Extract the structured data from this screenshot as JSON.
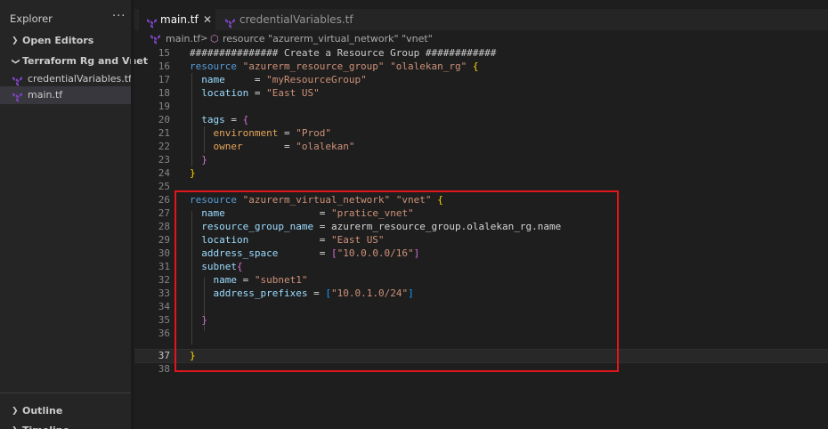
{
  "sidebar": {
    "title": "Explorer",
    "more": "···",
    "sections": {
      "open_editors": "Open Editors",
      "folder": "Terraform Rg and Vnet",
      "outline": "Outline",
      "timeline": "Timeline"
    },
    "files": [
      {
        "name": "credentialVariables.tf"
      },
      {
        "name": "main.tf"
      }
    ]
  },
  "tabs": [
    {
      "label": "main.tf",
      "close": "✕",
      "active": true
    },
    {
      "label": "credentialVariables.tf",
      "active": false
    }
  ],
  "breadcrumb": {
    "file": "main.tf",
    "sep": ">",
    "symbol": "resource \"azurerm_virtual_network\" \"vnet\""
  },
  "colors": {
    "terraform_icon": "#7b42bc",
    "highlight_box": "#e0161b"
  },
  "editor": {
    "line_numbers": [
      "15",
      "16",
      "17",
      "18",
      "19",
      "20",
      "21",
      "22",
      "23",
      "24",
      "25",
      "26",
      "27",
      "28",
      "29",
      "30",
      "31",
      "32",
      "33",
      "34",
      "35",
      "36",
      "37",
      "38"
    ],
    "current_line": "37",
    "lines": {
      "l15": "############### Create a Resource Group ############",
      "l16_kw": "resource",
      "l16_s1": "\"azurerm_resource_group\"",
      "l16_s2": "\"olalekan_rg\"",
      "l16_br": "{",
      "l17_key": "name",
      "l17_eq": "     = ",
      "l17_val": "\"myResourceGroup\"",
      "l18_key": "location",
      "l18_eq": " = ",
      "l18_val": "\"East US\"",
      "l20_key": "tags",
      "l20_eq": " = ",
      "l20_br": "{",
      "l21_key": "environment",
      "l21_eq": " = ",
      "l21_val": "\"Prod\"",
      "l22_key": "owner",
      "l22_eq": "       = ",
      "l22_val": "\"olalekan\"",
      "l23_br": "}",
      "l24_br": "}",
      "l26_kw": "resource",
      "l26_s1": "\"azurerm_virtual_network\"",
      "l26_s2": "\"vnet\"",
      "l26_br": "{",
      "l27_key": "name",
      "l27_eq": "                = ",
      "l27_val": "\"pratice_vnet\"",
      "l28_key": "resource_group_name",
      "l28_eq": " = ",
      "l28_val": "azurerm_resource_group.olalekan_rg.name",
      "l29_key": "location",
      "l29_eq": "            = ",
      "l29_val": "\"East US\"",
      "l30_key": "address_space",
      "l30_eq": "       = ",
      "l30_lb": "[",
      "l30_val": "\"10.0.0.0/16\"",
      "l30_rb": "]",
      "l31_key": "subnet",
      "l31_br": "{",
      "l32_key": "name",
      "l32_eq": " = ",
      "l32_val": "\"subnet1\"",
      "l33_key": "address_prefixes",
      "l33_eq": " = ",
      "l33_lb": "[",
      "l33_val": "\"10.0.1.0/24\"",
      "l33_rb": "]",
      "l35_br": "}",
      "l37_br": "}"
    }
  }
}
